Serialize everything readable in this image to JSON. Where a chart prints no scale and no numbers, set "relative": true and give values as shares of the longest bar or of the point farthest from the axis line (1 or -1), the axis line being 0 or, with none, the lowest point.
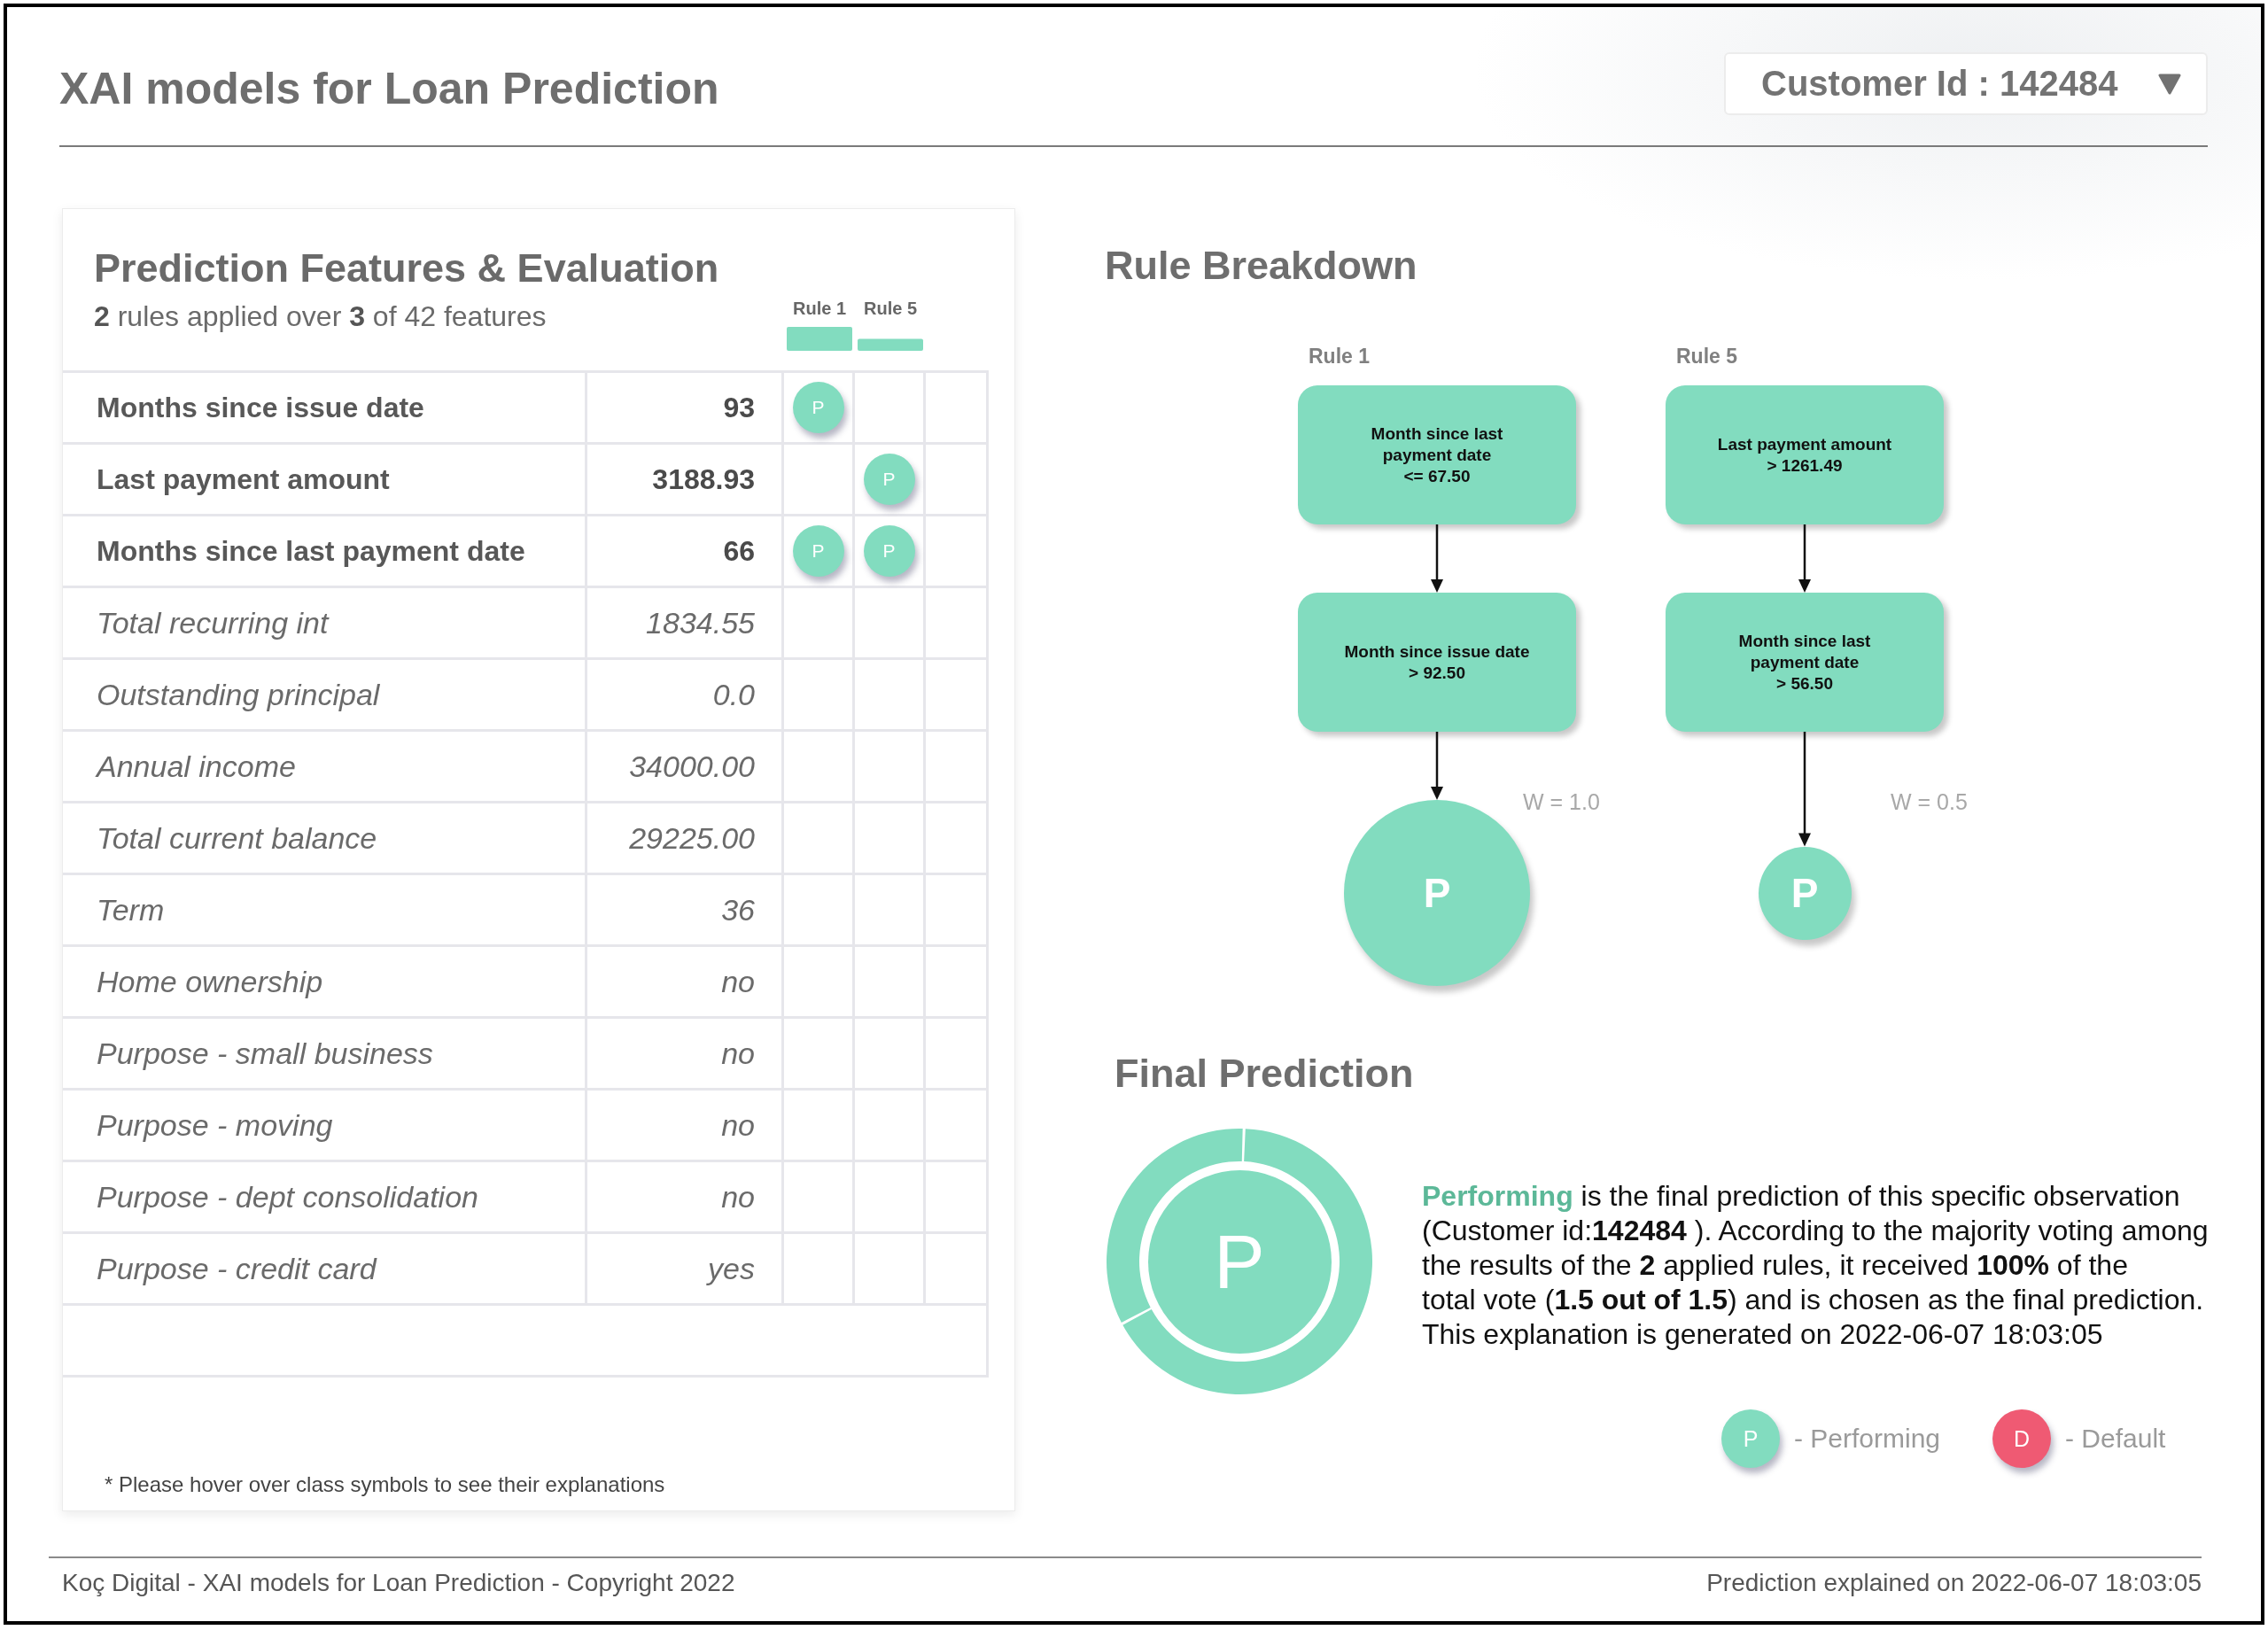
{
  "header": {
    "title": "XAI models for Loan Prediction",
    "customer_selector": {
      "value": "Customer Id : 142484"
    }
  },
  "features_panel": {
    "title": "Prediction Features & Evaluation",
    "subtitle": "**2** rules applied over **3** of 42 features",
    "chart_data": {
      "type": "bar",
      "relative": true,
      "categories": [
        "Rule 1",
        "Rule 5"
      ],
      "values": [
        1.0,
        0.5
      ]
    },
    "rows": [
      {
        "feature": "Months since issue date",
        "value": "93",
        "used": true,
        "rule_cells": [
          {
            "hit": true,
            "symbol": "P"
          },
          {
            "hit": false
          }
        ]
      },
      {
        "feature": "Last payment amount",
        "value": "3188.93",
        "used": true,
        "rule_cells": [
          {
            "hit": false
          },
          {
            "hit": true,
            "symbol": "P"
          }
        ]
      },
      {
        "feature": "Months since last payment date",
        "value": "66",
        "used": true,
        "rule_cells": [
          {
            "hit": true,
            "symbol": "P"
          },
          {
            "hit": true,
            "symbol": "P"
          }
        ]
      },
      {
        "feature": "Total recurring int",
        "value": "1834.55",
        "used": false,
        "rule_cells": [
          {
            "hit": false
          },
          {
            "hit": false
          }
        ]
      },
      {
        "feature": "Outstanding principal",
        "value": "0.0",
        "used": false,
        "rule_cells": [
          {
            "hit": false
          },
          {
            "hit": false
          }
        ]
      },
      {
        "feature": "Annual income",
        "value": "34000.00",
        "used": false,
        "rule_cells": [
          {
            "hit": false
          },
          {
            "hit": false
          }
        ]
      },
      {
        "feature": "Total current balance",
        "value": "29225.00",
        "used": false,
        "rule_cells": [
          {
            "hit": false
          },
          {
            "hit": false
          }
        ]
      },
      {
        "feature": "Term",
        "value": "36",
        "used": false,
        "rule_cells": [
          {
            "hit": false
          },
          {
            "hit": false
          }
        ]
      },
      {
        "feature": "Home ownership",
        "value": "no",
        "used": false,
        "rule_cells": [
          {
            "hit": false
          },
          {
            "hit": false
          }
        ]
      },
      {
        "feature": "Purpose - small business",
        "value": "no",
        "used": false,
        "rule_cells": [
          {
            "hit": false
          },
          {
            "hit": false
          }
        ]
      },
      {
        "feature": "Purpose - moving",
        "value": "no",
        "used": false,
        "rule_cells": [
          {
            "hit": false
          },
          {
            "hit": false
          }
        ]
      },
      {
        "feature": "Purpose - dept consolidation",
        "value": "no",
        "used": false,
        "rule_cells": [
          {
            "hit": false
          },
          {
            "hit": false
          }
        ]
      },
      {
        "feature": "Purpose - credit card",
        "value": "yes",
        "used": false,
        "rule_cells": [
          {
            "hit": false
          },
          {
            "hit": false
          }
        ]
      }
    ],
    "footnote": "* Please hover over class symbols to see their explanations"
  },
  "rule_breakdown": {
    "title": "Rule Breakdown",
    "rules": [
      {
        "label": "Rule 1",
        "conditions": [
          {
            "feature": "Month since last payment date",
            "condition": "<= 67.50"
          },
          {
            "feature": "Month since issue date",
            "condition": "> 92.50"
          }
        ],
        "weight": "W = 1.0",
        "symbol": "P"
      },
      {
        "label": "Rule 5",
        "conditions": [
          {
            "feature": "Last payment amount",
            "condition": "> 1261.49"
          },
          {
            "feature": "Month since last payment date",
            "condition": "> 56.50"
          }
        ],
        "weight": "W = 0.5",
        "symbol": "P"
      }
    ]
  },
  "final_prediction": {
    "title": "Final Prediction",
    "symbol": "P",
    "explanation_lines": [
      "**Performing** is the final prediction of this specific observation",
      "(Customer id:**142484** ). According to the majority voting among",
      "the results of the **2** applied rules, it received **100%** of the",
      "total vote (**1.5 out of 1.5**) and is chosen as the final prediction.",
      "This explanation is generated on 2022-06-07 18:03:05"
    ],
    "legend": [
      {
        "symbol": "P",
        "label": "- Performing",
        "color": "#82dcbf"
      },
      {
        "symbol": "D",
        "label": "- Default",
        "color": "#ef5a73"
      }
    ]
  },
  "footer": {
    "left": "Koç Digital - XAI models for Loan Prediction - Copyright 2022",
    "right": "Prediction explained on 2022-06-07 18:03:05"
  }
}
